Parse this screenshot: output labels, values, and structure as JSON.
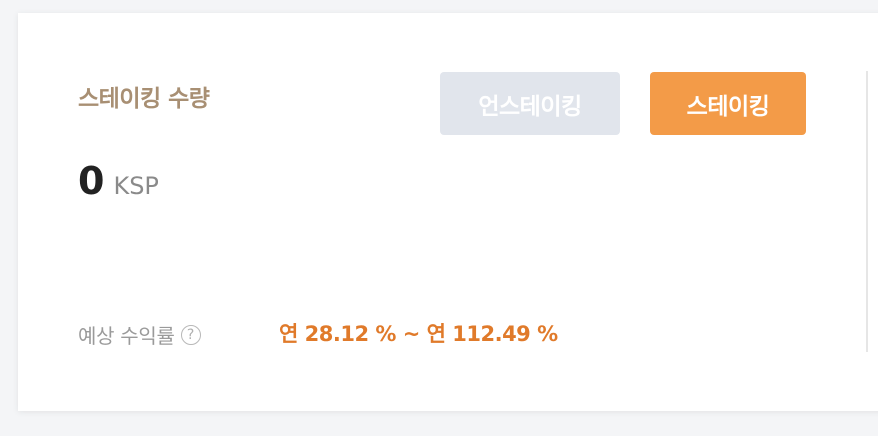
{
  "staking": {
    "title": "스테이킹 수량",
    "unstake_label": "언스테이킹",
    "stake_label": "스테이킹",
    "amount": "0",
    "unit": "KSP",
    "yield_label": "예상 수익률",
    "help_symbol": "?",
    "yield_range": "연 28.12 % ~ 연 112.49 %"
  },
  "colors": {
    "accent": "#f39b48",
    "yield_text": "#e07a2a",
    "title_text": "#a88f73",
    "disabled_button": "#e1e5ec"
  },
  "icons": {
    "help": "question-circle-icon"
  }
}
